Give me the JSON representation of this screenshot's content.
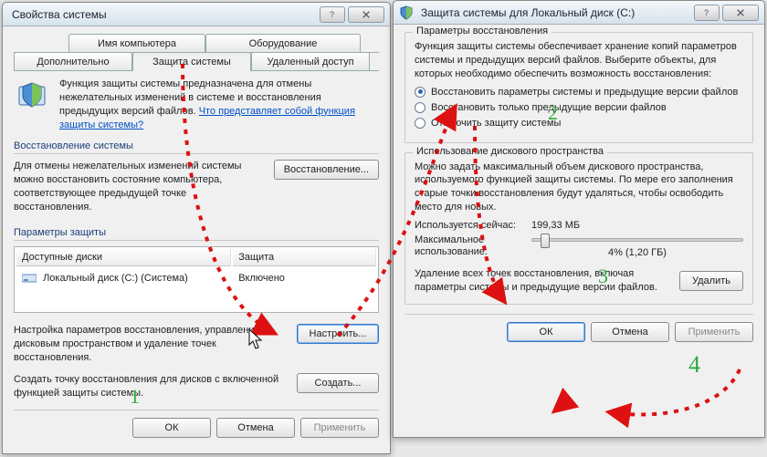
{
  "window1": {
    "title": "Свойства системы",
    "tabs": {
      "computer_name": "Имя компьютера",
      "hardware": "Оборудование",
      "advanced": "Дополнительно",
      "system_protection": "Защита системы",
      "remote": "Удаленный доступ"
    },
    "intro_text": "Функция защиты системы предназначена для отмены нежелательных изменений в системе и восстановления предыдущих версий файлов. ",
    "intro_link": "Что представляет собой функция защиты системы?",
    "restore_group_title": "Восстановление системы",
    "restore_text": "Для отмены нежелательных изменений системы можно восстановить состояние компьютера, соответствующее предыдущей точке восстановления.",
    "restore_button": "Восстановление...",
    "protection_group_title": "Параметры защиты",
    "table": {
      "col_drives": "Доступные диски",
      "col_protection": "Защита",
      "row_drive": "Локальный диск (C:) (Система)",
      "row_status": "Включено"
    },
    "configure_text": "Настройка параметров восстановления, управление дисковым пространством и удаление точек восстановления.",
    "configure_button": "Настроить...",
    "create_text": "Создать точку восстановления для дисков с включенной функцией защиты системы.",
    "create_button": "Создать...",
    "footer": {
      "ok": "ОК",
      "cancel": "Отмена",
      "apply": "Применить"
    }
  },
  "window2": {
    "title": "Защита системы для Локальный диск (C:)",
    "group1_title": "Параметры восстановления",
    "group1_text": "Функция защиты системы обеспечивает хранение копий параметров системы и предыдущих версий файлов. Выберите объекты, для которых необходимо обеспечить возможность восстановления:",
    "radio1": "Восстановить параметры системы и предыдущие версии файлов",
    "radio2": "Восстановить только предыдущие версии файлов",
    "radio3": "Отключить защиту системы",
    "group2_title": "Использование дискового пространства",
    "group2_text": "Можно задать максимальный объем дискового пространства, используемого функцией защиты системы. По мере его заполнения старые точки восстановления будут удаляться, чтобы освободить место для новых.",
    "usage_label": "Используется сейчас:",
    "usage_value": "199,33 МБ",
    "max_label": "Максимальное использование:",
    "max_value_text": "4% (1,20 ГБ)",
    "delete_text": "Удаление всех точек восстановления, включая параметры системы и предыдущие версии файлов.",
    "delete_button": "Удалить",
    "footer": {
      "ok": "ОК",
      "cancel": "Отмена",
      "apply": "Применить"
    }
  },
  "annotations": {
    "n1": "1",
    "n2": "2",
    "n3": "3",
    "n4": "4"
  }
}
